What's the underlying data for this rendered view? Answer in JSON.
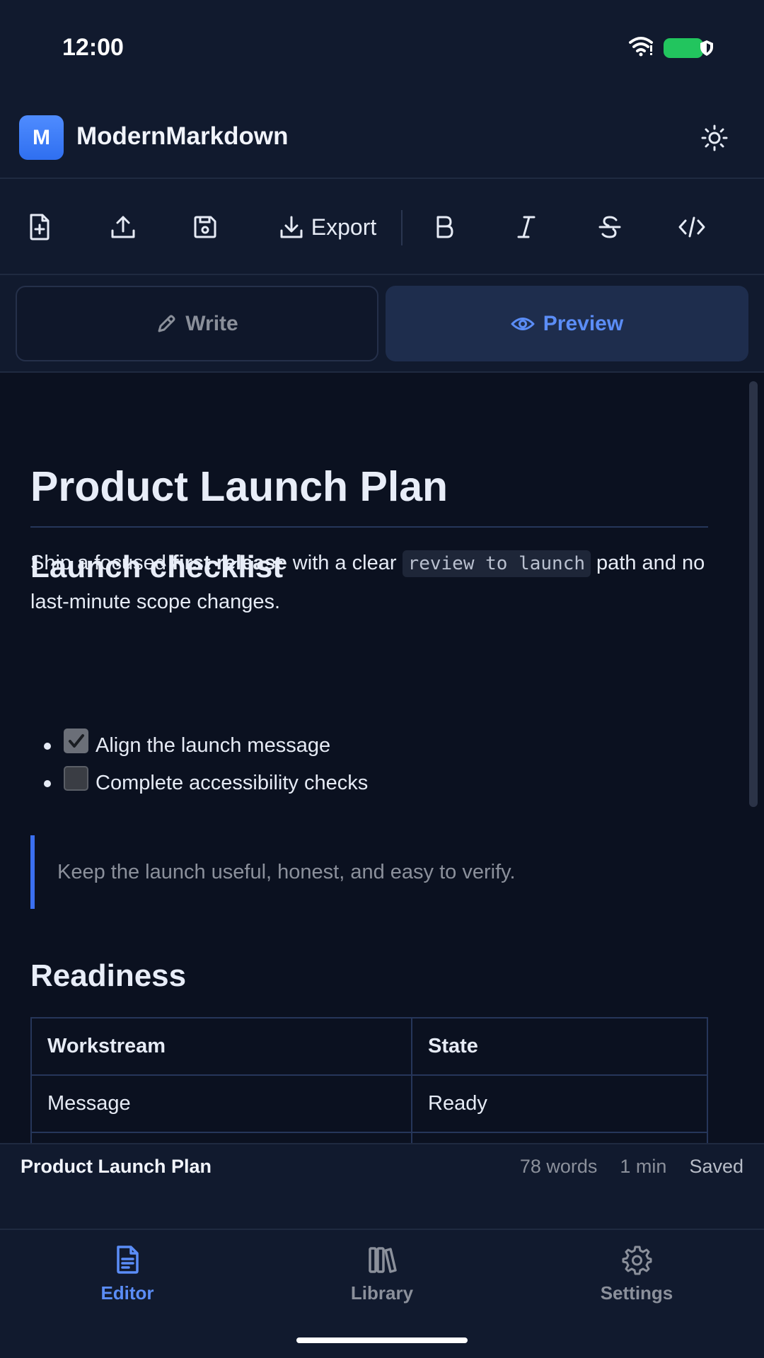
{
  "status": {
    "time": "12:00"
  },
  "app": {
    "logo_letter": "M",
    "title": "ModernMarkdown"
  },
  "toolbar": {
    "export_label": "Export"
  },
  "tabs": {
    "write": "Write",
    "preview": "Preview"
  },
  "document": {
    "title": "Product Launch Plan",
    "intro": {
      "part1": "Ship a focused ",
      "bold": "first release",
      "part2": " with a clear ",
      "code": "review to launch",
      "part3": " path and no last-minute scope changes."
    },
    "checklist_heading": "Launch checklist",
    "checklist": [
      {
        "label": "Align the launch message",
        "checked": true
      },
      {
        "label": "Complete accessibility checks",
        "checked": false
      }
    ],
    "quote": "Keep the launch useful, honest, and easy to verify.",
    "readiness_heading": "Readiness",
    "table": {
      "headers": [
        "Workstream",
        "State"
      ],
      "rows": [
        [
          "Message",
          "Ready"
        ],
        [
          "",
          ""
        ]
      ]
    }
  },
  "footer": {
    "doc_name": "Product Launch Plan",
    "words": "78 words",
    "read_time": "1 min",
    "save_state": "Saved"
  },
  "nav": {
    "editor": "Editor",
    "library": "Library",
    "settings": "Settings"
  },
  "colors": {
    "accent": "#5b8df7",
    "background": "#0b1120",
    "surface": "#111a2e",
    "battery": "#22c55e"
  }
}
